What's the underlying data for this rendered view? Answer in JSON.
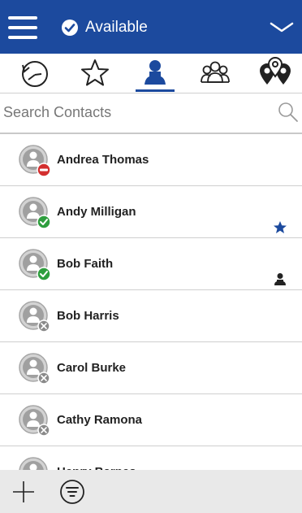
{
  "header": {
    "status_label": "Available",
    "status_color": "#2196f3",
    "background": "#1c4a9e"
  },
  "tabs": [
    {
      "id": "recent",
      "icon": "clock-history-icon",
      "active": false
    },
    {
      "id": "favorites",
      "icon": "star-outline-icon",
      "active": false
    },
    {
      "id": "contacts",
      "icon": "person-icon",
      "active": true
    },
    {
      "id": "groups",
      "icon": "group-icon",
      "active": false
    },
    {
      "id": "locations",
      "icon": "map-pin-icon",
      "active": false
    }
  ],
  "search": {
    "placeholder": "Search Contacts"
  },
  "contacts": [
    {
      "name": "Andrea Thomas",
      "presence": "busy",
      "extra": ""
    },
    {
      "name": "Andy Milligan",
      "presence": "available",
      "extra": "star-icon"
    },
    {
      "name": "Bob Faith",
      "presence": "available",
      "extra": "person-icon"
    },
    {
      "name": "Bob Harris",
      "presence": "offline",
      "extra": ""
    },
    {
      "name": "Carol Burke",
      "presence": "offline",
      "extra": ""
    },
    {
      "name": "Cathy Ramona",
      "presence": "offline",
      "extra": ""
    },
    {
      "name": "Henry Barnes",
      "presence": "offline",
      "extra": ""
    }
  ],
  "presence_colors": {
    "busy": "#d32f2f",
    "available": "#2e9e3e",
    "offline": "#8a8a8a"
  },
  "bottom_bar": {
    "add_icon": "plus-icon",
    "filter_icon": "filter-icon"
  }
}
